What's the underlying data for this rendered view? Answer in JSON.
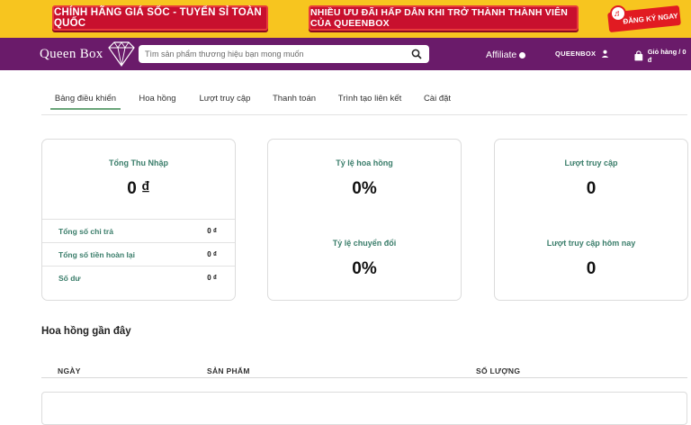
{
  "promo": {
    "banner_left": "CHÍNH HÃNG GIÁ SỐC - TUYỂN SỈ TOÀN QUỐC",
    "banner_middle": "NHIỀU ƯU ĐÃI HẤP DẪN KHI TRỞ THÀNH THÀNH VIÊN CỦA QUEENBOX",
    "signup_label": "ĐĂNG KÝ NGAY"
  },
  "header": {
    "logo_text": "Queen Box",
    "search_placeholder": "Tìm sản phẩm thương hiệu bạn mong muốn",
    "affiliate_label": "Affiliate",
    "account_label": "QUEENBOX",
    "cart_label": "Giỏ hàng / 0 đ"
  },
  "tabs": [
    {
      "label": "Bảng điều khiển",
      "active": true
    },
    {
      "label": "Hoa hồng"
    },
    {
      "label": "Lượt truy cập"
    },
    {
      "label": "Thanh toán"
    },
    {
      "label": "Trình tạo liên kết"
    },
    {
      "label": "Cài đặt"
    }
  ],
  "earnings_card": {
    "label": "Tổng Thu Nhập",
    "value": "0 ₫",
    "rows": [
      {
        "label": "Tổng số chi trả",
        "value": "0 ₫"
      },
      {
        "label": "Tổng số tiền hoàn lại",
        "value": "0 ₫"
      },
      {
        "label": "Số dư",
        "value": "0 ₫"
      }
    ]
  },
  "rates_card": {
    "commission_label": "Tỷ lệ hoa hồng",
    "commission_value": "0%",
    "conversion_label": "Tỷ lệ chuyển đổi",
    "conversion_value": "0%"
  },
  "visits_card": {
    "visits_label": "Lượt truy cập",
    "visits_value": "0",
    "today_label": "Lượt truy cập hôm nay",
    "today_value": "0"
  },
  "recent": {
    "title": "Hoa hồng gần đây",
    "columns": [
      "NGÀY",
      "SẢN PHẨM",
      "SỐ LƯỢNG"
    ]
  },
  "colors": {
    "promo_bg": "#f7c51f",
    "header_bg": "#6a1b6a",
    "accent_green": "#3a7d6a",
    "promo_red": "#c8102e"
  }
}
